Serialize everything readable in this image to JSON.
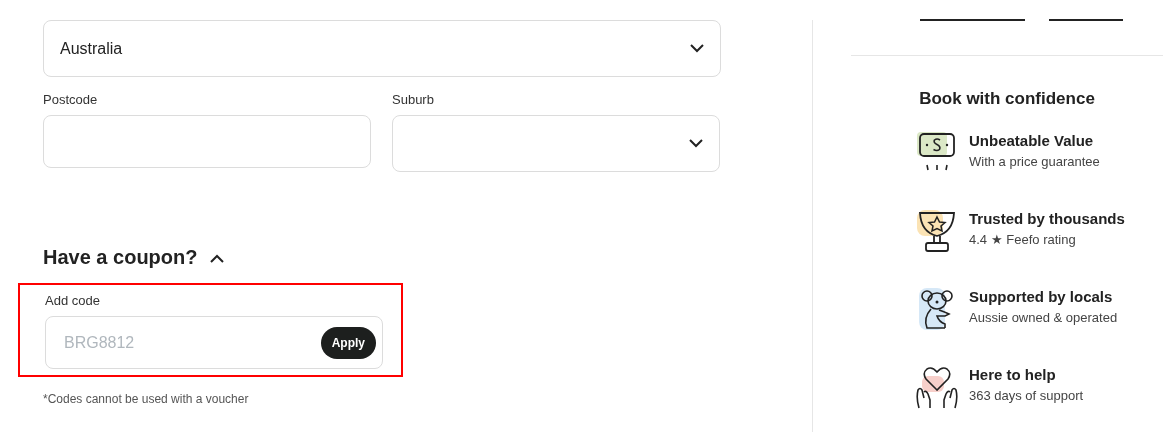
{
  "address": {
    "country": {
      "value": "Australia"
    },
    "postcode": {
      "label": "Postcode"
    },
    "suburb": {
      "label": "Suburb"
    }
  },
  "coupon": {
    "title": "Have a coupon?",
    "expanded": true,
    "highlighted": true,
    "label": "Add code",
    "placeholder": "BRG8812",
    "button": "Apply",
    "note": "*Codes cannot be used with a voucher"
  },
  "confidence": {
    "title": "Book with confidence",
    "items": [
      {
        "kind": "value",
        "title": "Unbeatable Value",
        "subtitle": "With a price guarantee"
      },
      {
        "kind": "trophy",
        "title": "Trusted by thousands",
        "subtitle": "4.4 ★ Feefo rating"
      },
      {
        "kind": "koala",
        "title": "Supported by locals",
        "subtitle": "Aussie owned & operated"
      },
      {
        "kind": "help",
        "title": "Here to help",
        "subtitle": "363 days of support"
      }
    ]
  }
}
